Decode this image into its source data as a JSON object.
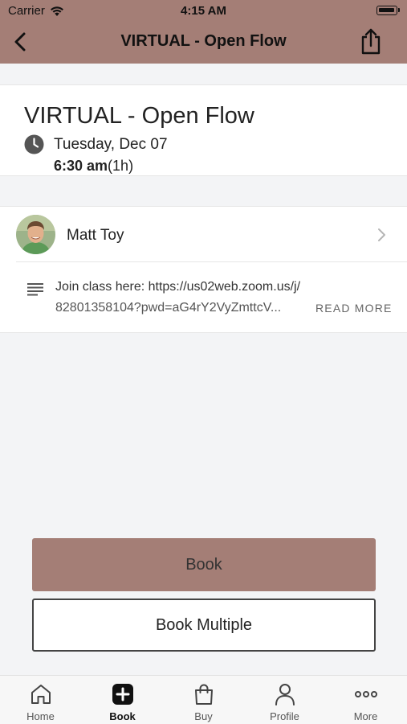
{
  "status_bar": {
    "carrier": "Carrier",
    "time": "4:15 AM"
  },
  "nav": {
    "title": "VIRTUAL - Open Flow",
    "back_icon": "chevron-left-icon",
    "share_icon": "share-icon"
  },
  "class": {
    "title": "VIRTUAL - Open Flow",
    "date": "Tuesday, Dec 07",
    "time": "6:30 am",
    "duration": "(1h)"
  },
  "instructor": {
    "name": "Matt Toy"
  },
  "description": {
    "line1": "Join class here: https://us02web.zoom.us/j/",
    "line2": "82801358104?pwd=aG4rY2VyZmttcV...",
    "read_more": "READ MORE"
  },
  "actions": {
    "book": "Book",
    "book_multiple": "Book Multiple"
  },
  "tabs": [
    {
      "label": "Home",
      "icon": "home-icon"
    },
    {
      "label": "Book",
      "icon": "plus-square-icon",
      "active": true
    },
    {
      "label": "Buy",
      "icon": "shopping-bag-icon"
    },
    {
      "label": "Profile",
      "icon": "person-icon"
    },
    {
      "label": "More",
      "icon": "more-dots-icon"
    }
  ],
  "colors": {
    "brand": "#a47e76",
    "background": "#f3f4f6"
  }
}
